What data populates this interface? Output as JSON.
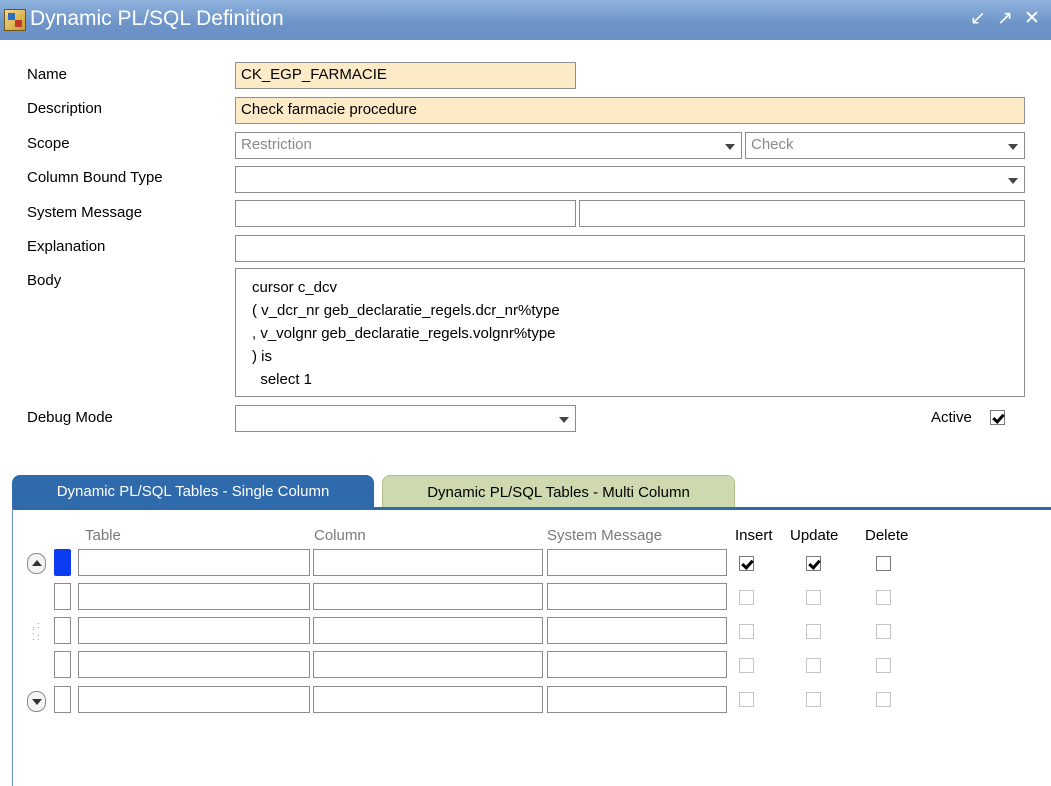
{
  "window": {
    "title": "Dynamic PL/SQL Definition",
    "buttons": [
      "minimize-icon",
      "maximize-icon",
      "close-icon"
    ]
  },
  "form": {
    "name_label": "Name",
    "name_value": "CK_EGP_FARMACIE",
    "description_label": "Description",
    "description_value": "Check farmacie procedure",
    "scope_label": "Scope",
    "scope_value1": "Restriction",
    "scope_value2": "Check",
    "column_bound_type_label": "Column Bound Type",
    "column_bound_type_value": "",
    "system_message_label": "System Message",
    "system_message_value1": "",
    "system_message_value2": "",
    "explanation_label": "Explanation",
    "explanation_value": "",
    "body_label": "Body",
    "body_lines": [
      "cursor c_dcv",
      "( v_dcr_nr geb_declaratie_regels.dcr_nr%type",
      ", v_volgnr geb_declaratie_regels.volgnr%type",
      ") is",
      "  select 1"
    ],
    "debug_mode_label": "Debug Mode",
    "debug_mode_value": "",
    "active_label": "Active",
    "active_checked": true
  },
  "tabs": [
    {
      "label": "Dynamic PL/SQL Tables - Single Column",
      "active": true
    },
    {
      "label": "Dynamic PL/SQL Tables - Multi Column",
      "active": false
    }
  ],
  "grid": {
    "headers": {
      "table": "Table",
      "column": "Column",
      "system_message": "System Message",
      "insert": "Insert",
      "update": "Update",
      "delete": "Delete"
    },
    "rows": [
      {
        "table": "",
        "column": "",
        "system_message": "",
        "insert": true,
        "update": true,
        "delete": false
      },
      {
        "table": "",
        "column": "",
        "system_message": "",
        "insert": false,
        "update": false,
        "delete": false
      },
      {
        "table": "",
        "column": "",
        "system_message": "",
        "insert": false,
        "update": false,
        "delete": false
      },
      {
        "table": "",
        "column": "",
        "system_message": "",
        "insert": false,
        "update": false,
        "delete": false
      },
      {
        "table": "",
        "column": "",
        "system_message": "",
        "insert": false,
        "update": false,
        "delete": false
      }
    ]
  },
  "colors": {
    "titlebar": "#7aa0d2",
    "required_field": "#fdebc7",
    "tab_active": "#2f6aad",
    "tab_inactive": "#cfd9b0",
    "current_row": "#0b3cf2"
  }
}
